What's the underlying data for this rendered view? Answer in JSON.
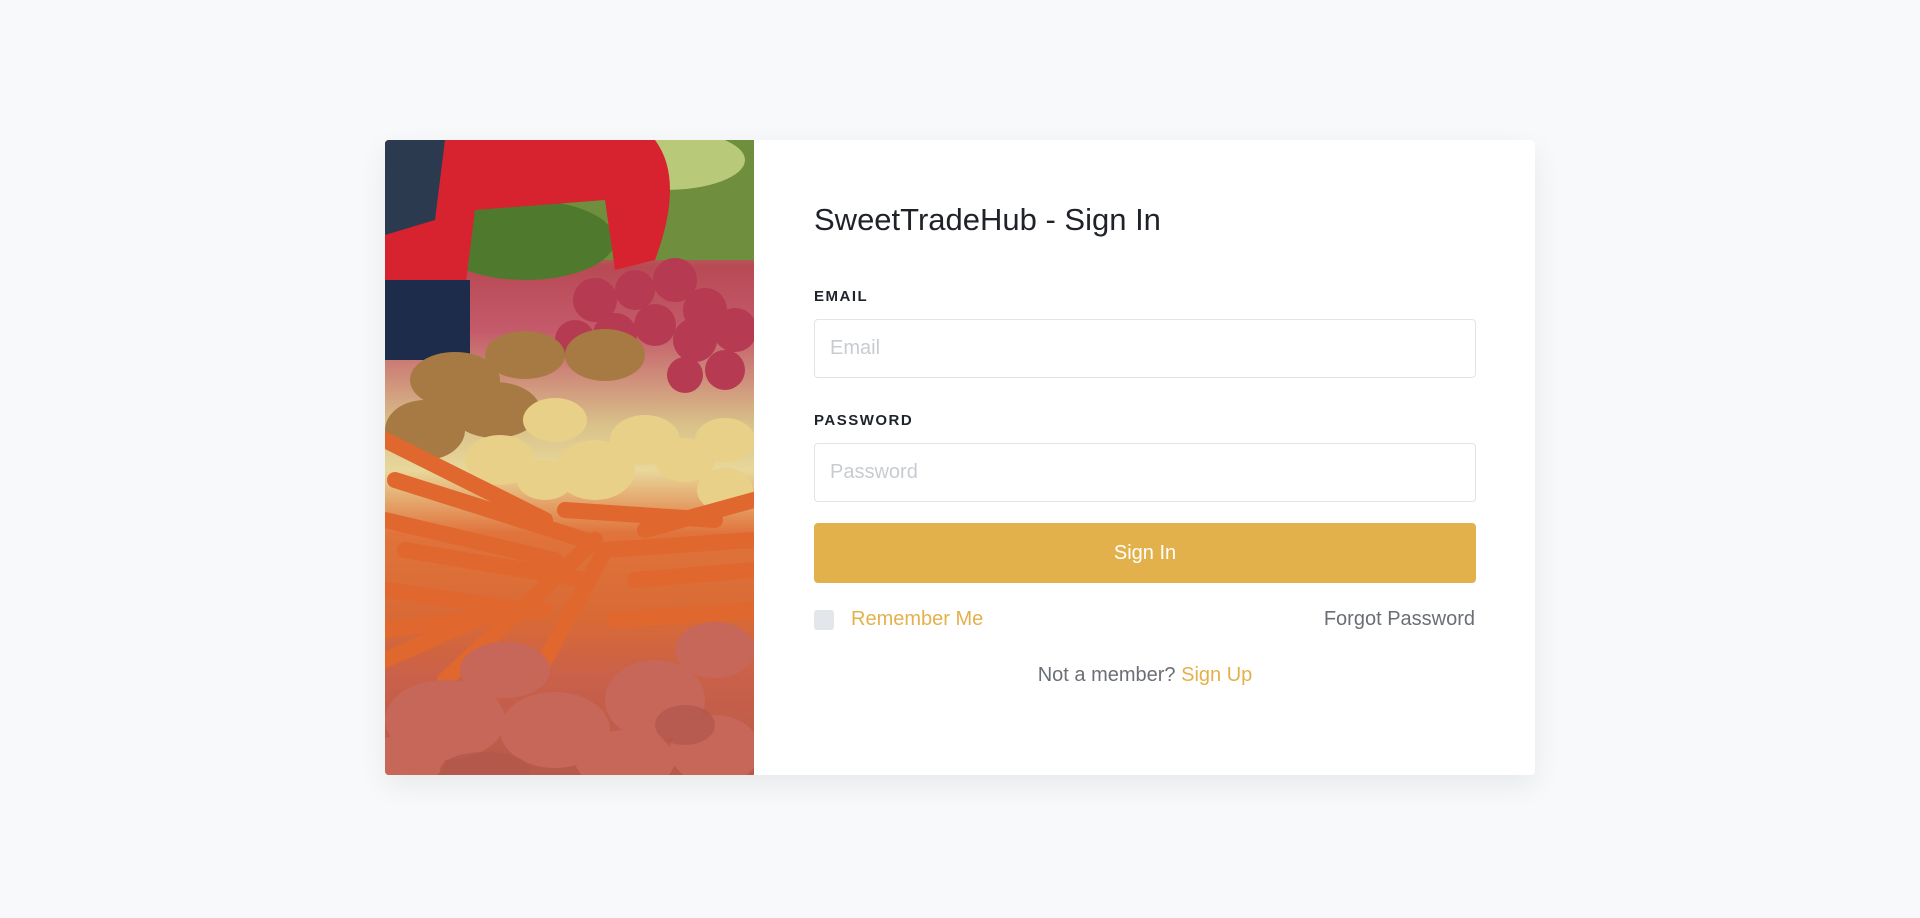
{
  "title": "SweetTradeHub - Sign In",
  "email": {
    "label": "EMAIL",
    "placeholder": "Email",
    "value": ""
  },
  "password": {
    "label": "PASSWORD",
    "placeholder": "Password",
    "value": ""
  },
  "signin_button": "Sign In",
  "remember_me": {
    "label": "Remember Me",
    "checked": false
  },
  "forgot_password": "Forgot Password",
  "signup_prompt": "Not a member?",
  "signup_link": "Sign Up",
  "colors": {
    "accent": "#e3b14b",
    "background": "#f8f9fb",
    "muted_text": "#6b6f75"
  }
}
